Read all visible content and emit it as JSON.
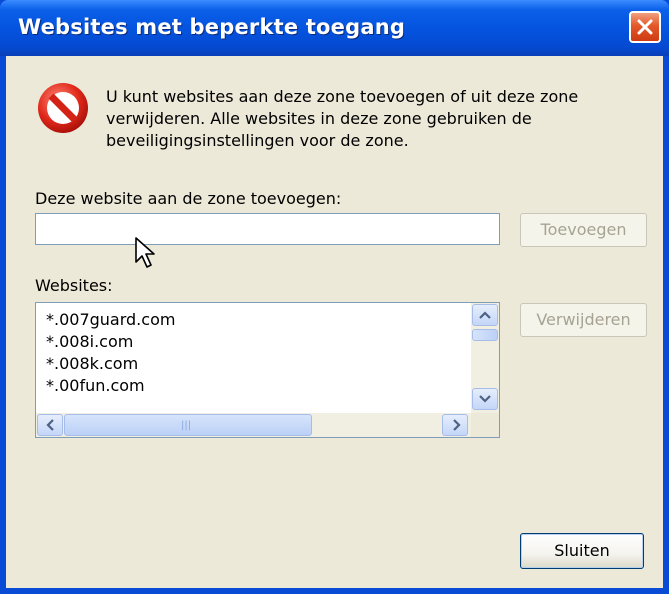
{
  "window": {
    "title": "Websites met beperkte toegang"
  },
  "icons": {
    "close": "close-icon",
    "warning": "restricted-icon"
  },
  "description": "U kunt websites aan deze zone toevoegen of uit deze zone verwijderen. Alle websites in deze zone gebruiken de beveiligingsinstellingen voor de zone.",
  "add": {
    "label": "Deze website aan de zone toevoegen:",
    "value": "",
    "button_label": "Toevoegen"
  },
  "sites": {
    "label": "Websites:",
    "items": [
      "*.007guard.com",
      "*.008i.com",
      "*.008k.com",
      "*.00fun.com"
    ],
    "remove_button_label": "Verwijderen"
  },
  "footer": {
    "close_button_label": "Sluiten"
  },
  "colors": {
    "titlebar": "#0554e0",
    "client": "#ece9d8",
    "close_button": "#e4582a",
    "disabled_text": "#a6a393"
  }
}
